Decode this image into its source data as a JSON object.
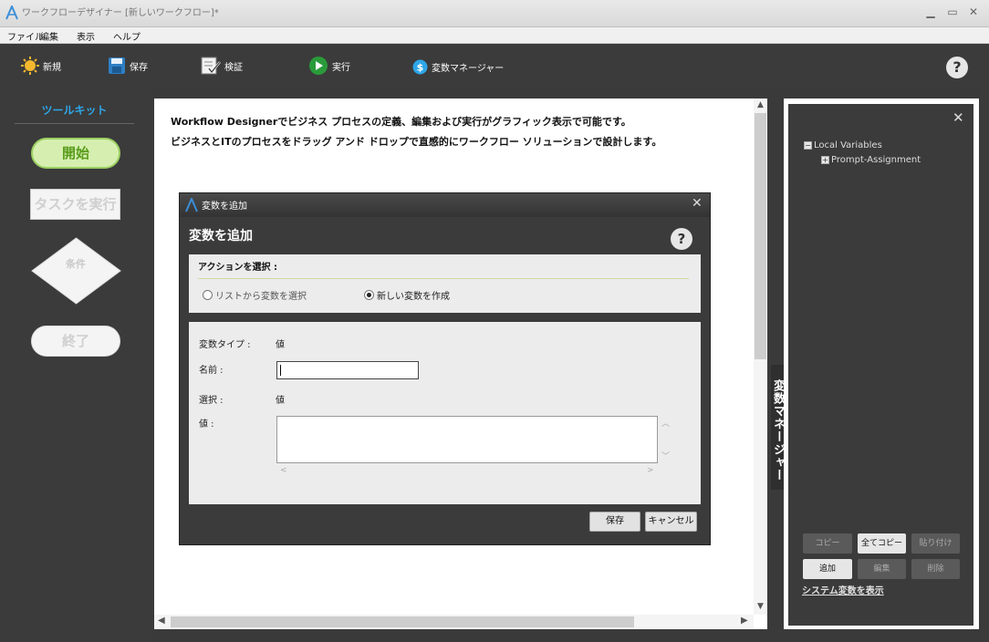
{
  "window": {
    "title": "ワークフローデザイナー [新しいワークフロー]*",
    "minimize": "▁",
    "maximize": "▭",
    "close": "✕"
  },
  "menu": [
    "ファイル",
    "編集",
    "表示",
    "ヘルプ"
  ],
  "toolbar": {
    "new": "新規",
    "save": "保存",
    "verify": "検証",
    "run": "実行",
    "variable_manager": "変数マネージャー",
    "help": "?"
  },
  "toolkit": {
    "title": "ツールキット",
    "start": "開始",
    "task": "タスクを実行",
    "condition": "条件",
    "end": "終了"
  },
  "canvas": {
    "line1": "Workflow Designerでビジネス プロセスの定義、編集および実行がグラフィック表示で可能です。",
    "line2": "ビジネスとITのプロセスをドラッグ アンド ドロップで直感的にワークフロー ソリューションで設計します。"
  },
  "dialog": {
    "title": "変数を追加",
    "heading": "変数を追加",
    "help": "?",
    "close": "✕",
    "action_label": "アクションを選択 :",
    "option_list": "リストから変数を選択",
    "option_new": "新しい変数を作成",
    "selected_option": "new",
    "type_label": "変数タイプ :",
    "type_value": "値",
    "name_label": "名前 :",
    "name_value": "",
    "select_label": "選択 :",
    "select_value": "値",
    "value_label": "値 :",
    "value_text": "",
    "save": "保存",
    "cancel": "キャンセル"
  },
  "variable_manager": {
    "tab_label": "変数マネージャー",
    "close": "✕",
    "tree": [
      {
        "expander": "−",
        "label": "Local Variables"
      },
      {
        "expander": "+",
        "label": "Prompt-Assignment"
      }
    ],
    "buttons": {
      "copy": "コピー",
      "copy_all": "全てコピー",
      "paste": "貼り付け",
      "add": "追加",
      "edit": "編集",
      "delete": "削除"
    },
    "system_link": "システム変数を表示"
  },
  "colors": {
    "accent_blue": "#2ea6e8",
    "start_green": "#5a9c1c",
    "panel_dark": "#3b3b3b"
  }
}
